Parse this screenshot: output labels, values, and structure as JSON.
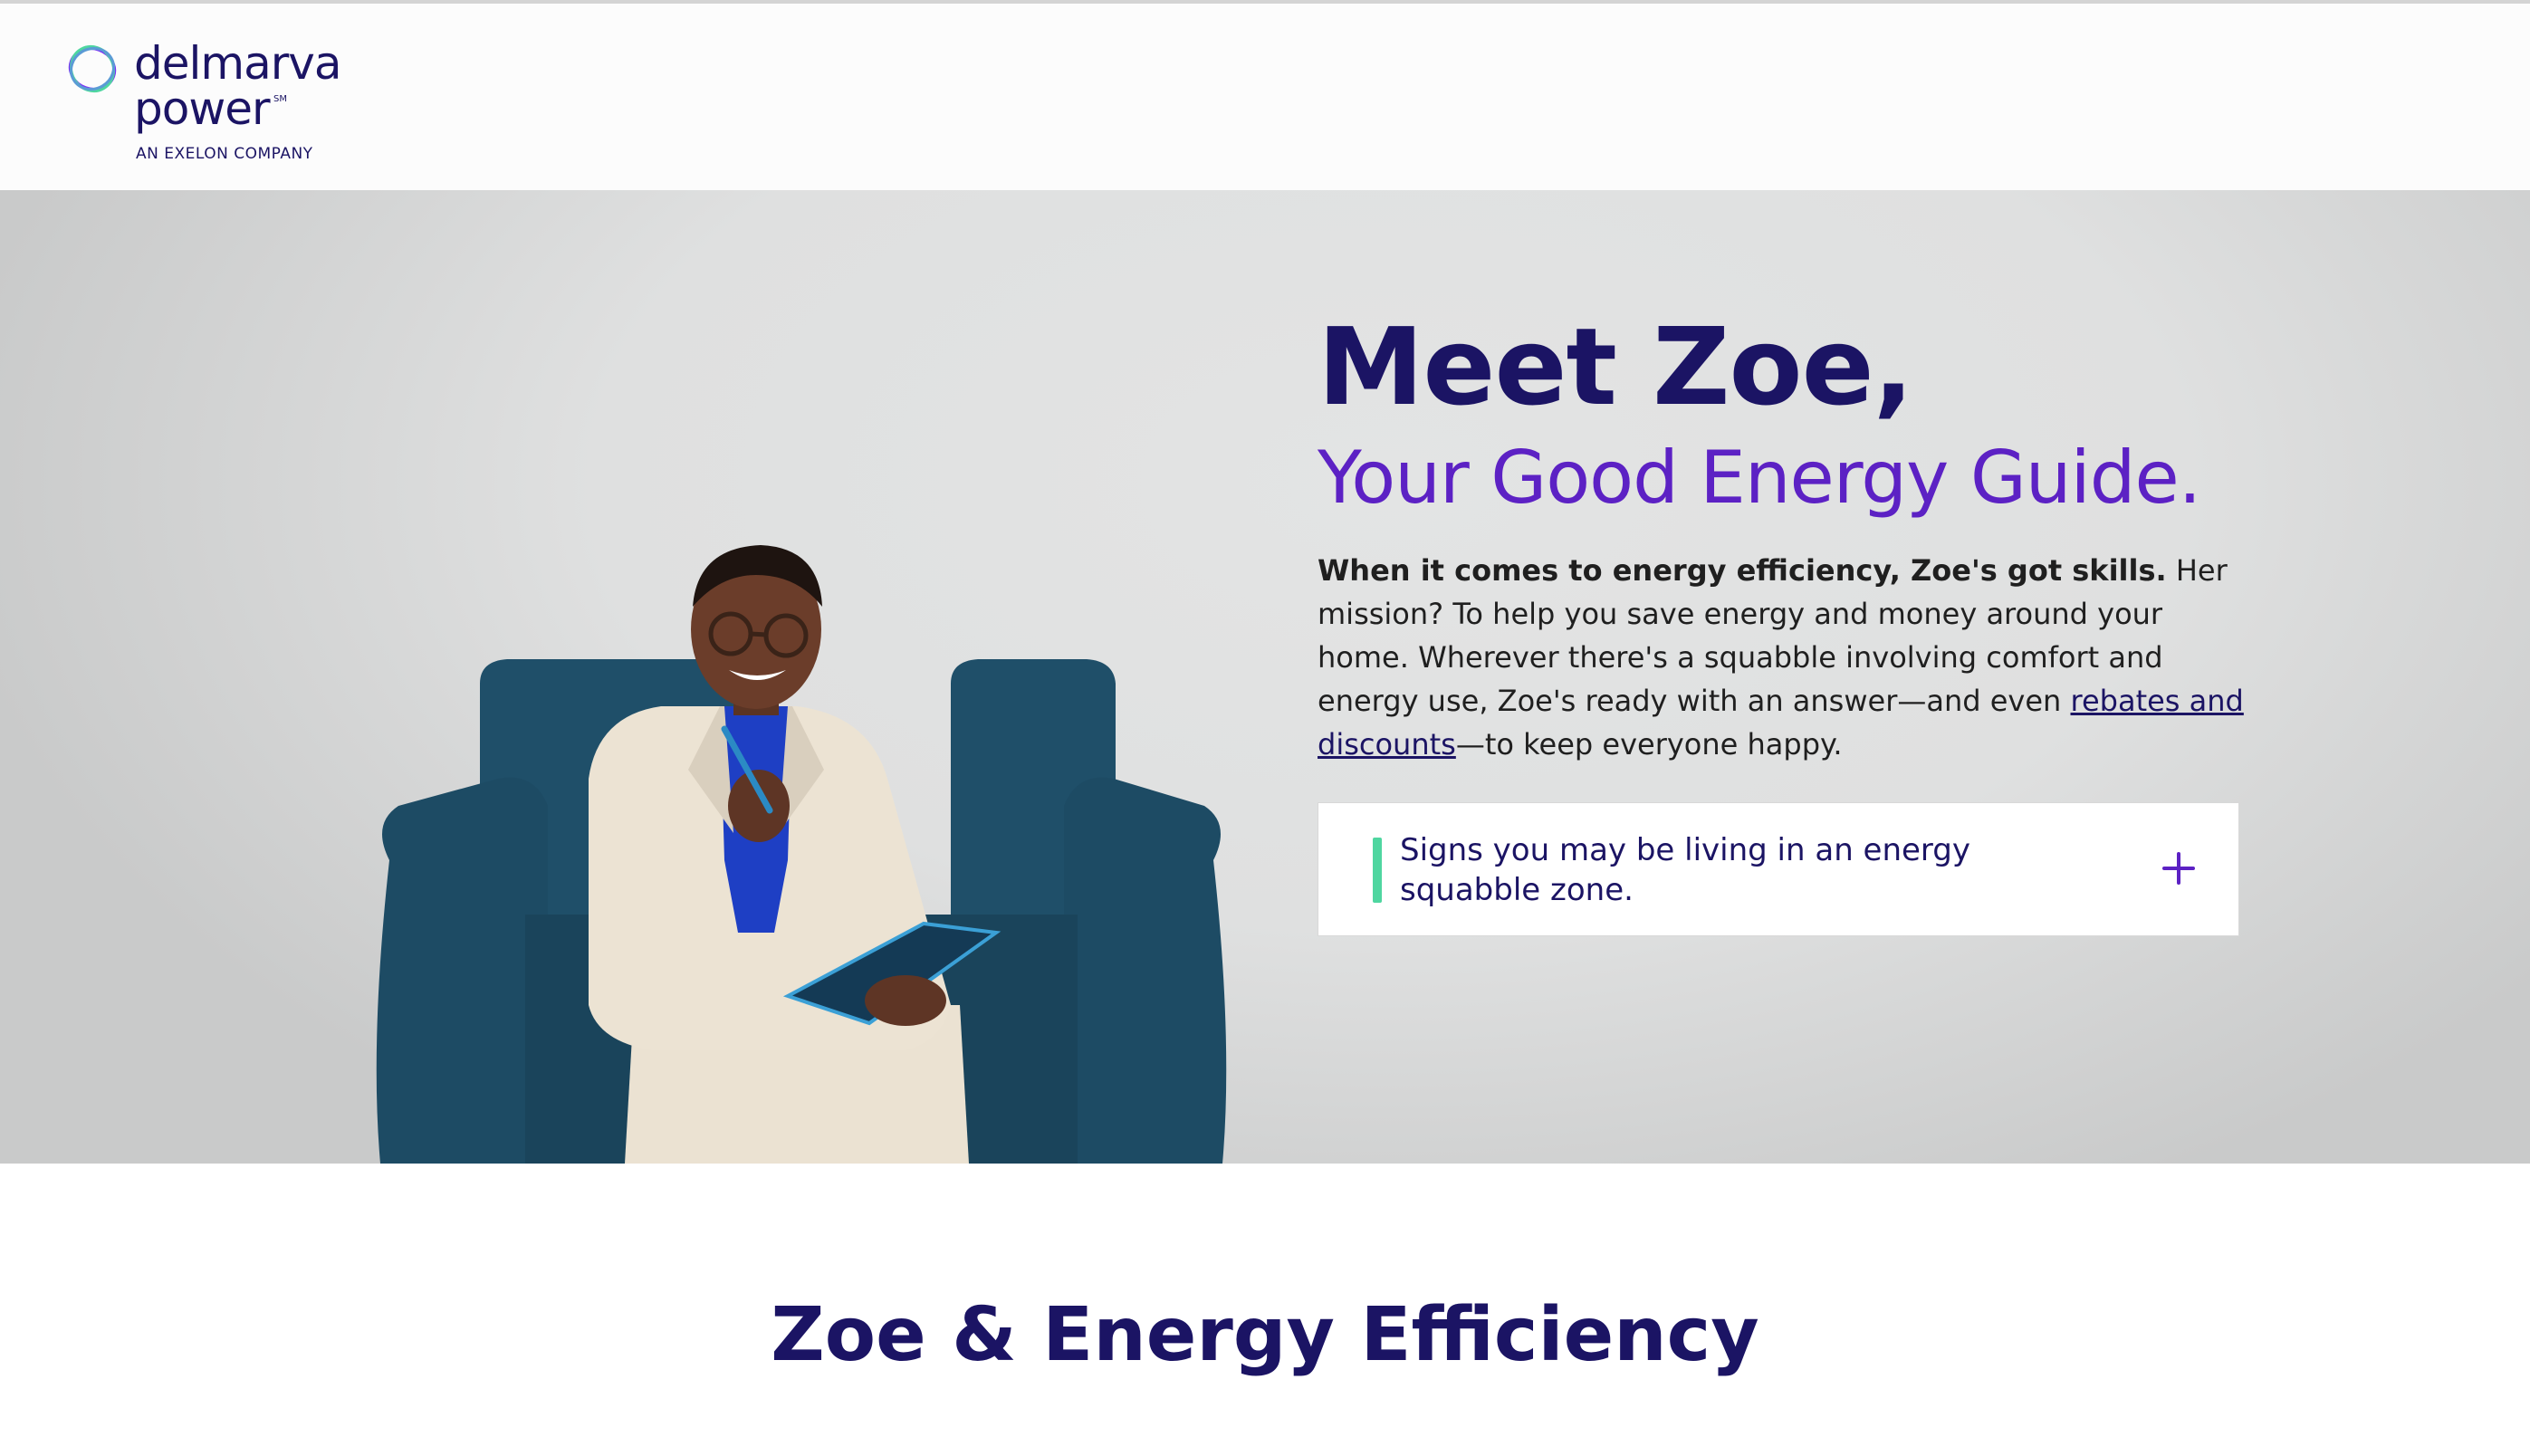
{
  "header": {
    "logo": {
      "line1": "delmarva",
      "line2": "power",
      "service_mark": "SM",
      "tagline": "AN EXELON COMPANY"
    }
  },
  "hero": {
    "title": "Meet Zoe,",
    "subtitle": "Your Good Energy Guide.",
    "body": {
      "lead_bold": "When it comes to energy efficiency, Zoe's got skills.",
      "text_before_link": " Her mission? To help you save energy and money around your home. Wherever there's a squabble involving comfort and energy use, Zoe's ready with an answer—and even ",
      "link_text": "rebates and discounts",
      "text_after_link": "—to keep everyone happy."
    },
    "accordion": {
      "label": "Signs you may be living in an energy squabble zone.",
      "toggle_icon": "plus-icon"
    },
    "image": {
      "subject": "zoe-portrait"
    }
  },
  "section": {
    "title": "Zoe & Energy Efficiency"
  },
  "colors": {
    "brand_navy": "#1b1464",
    "brand_purple": "#5c21c4",
    "accent_green": "#4fd6a0",
    "hero_bg": "#dfe0e0"
  }
}
